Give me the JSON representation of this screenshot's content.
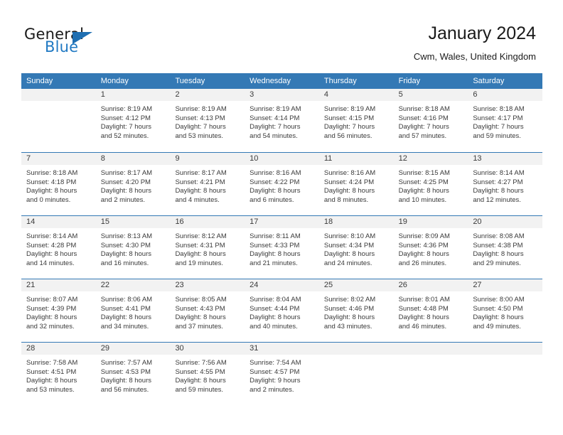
{
  "brand": {
    "word_general": "General",
    "word_blue": "Blue",
    "flag_icon": "triangle-flag-icon",
    "accent_color": "#2079c3"
  },
  "header": {
    "title": "January 2024",
    "subtitle": "Cwm, Wales, United Kingdom"
  },
  "calendar": {
    "header_bg": "#3479b5",
    "daynum_bg": "#f2f2f2",
    "weekdays": [
      "Sunday",
      "Monday",
      "Tuesday",
      "Wednesday",
      "Thursday",
      "Friday",
      "Saturday"
    ],
    "weeks": [
      [
        {
          "day": "",
          "lines": []
        },
        {
          "day": "1",
          "lines": [
            "Sunrise: 8:19 AM",
            "Sunset: 4:12 PM",
            "Daylight: 7 hours",
            "and 52 minutes."
          ]
        },
        {
          "day": "2",
          "lines": [
            "Sunrise: 8:19 AM",
            "Sunset: 4:13 PM",
            "Daylight: 7 hours",
            "and 53 minutes."
          ]
        },
        {
          "day": "3",
          "lines": [
            "Sunrise: 8:19 AM",
            "Sunset: 4:14 PM",
            "Daylight: 7 hours",
            "and 54 minutes."
          ]
        },
        {
          "day": "4",
          "lines": [
            "Sunrise: 8:19 AM",
            "Sunset: 4:15 PM",
            "Daylight: 7 hours",
            "and 56 minutes."
          ]
        },
        {
          "day": "5",
          "lines": [
            "Sunrise: 8:18 AM",
            "Sunset: 4:16 PM",
            "Daylight: 7 hours",
            "and 57 minutes."
          ]
        },
        {
          "day": "6",
          "lines": [
            "Sunrise: 8:18 AM",
            "Sunset: 4:17 PM",
            "Daylight: 7 hours",
            "and 59 minutes."
          ]
        }
      ],
      [
        {
          "day": "7",
          "lines": [
            "Sunrise: 8:18 AM",
            "Sunset: 4:18 PM",
            "Daylight: 8 hours",
            "and 0 minutes."
          ]
        },
        {
          "day": "8",
          "lines": [
            "Sunrise: 8:17 AM",
            "Sunset: 4:20 PM",
            "Daylight: 8 hours",
            "and 2 minutes."
          ]
        },
        {
          "day": "9",
          "lines": [
            "Sunrise: 8:17 AM",
            "Sunset: 4:21 PM",
            "Daylight: 8 hours",
            "and 4 minutes."
          ]
        },
        {
          "day": "10",
          "lines": [
            "Sunrise: 8:16 AM",
            "Sunset: 4:22 PM",
            "Daylight: 8 hours",
            "and 6 minutes."
          ]
        },
        {
          "day": "11",
          "lines": [
            "Sunrise: 8:16 AM",
            "Sunset: 4:24 PM",
            "Daylight: 8 hours",
            "and 8 minutes."
          ]
        },
        {
          "day": "12",
          "lines": [
            "Sunrise: 8:15 AM",
            "Sunset: 4:25 PM",
            "Daylight: 8 hours",
            "and 10 minutes."
          ]
        },
        {
          "day": "13",
          "lines": [
            "Sunrise: 8:14 AM",
            "Sunset: 4:27 PM",
            "Daylight: 8 hours",
            "and 12 minutes."
          ]
        }
      ],
      [
        {
          "day": "14",
          "lines": [
            "Sunrise: 8:14 AM",
            "Sunset: 4:28 PM",
            "Daylight: 8 hours",
            "and 14 minutes."
          ]
        },
        {
          "day": "15",
          "lines": [
            "Sunrise: 8:13 AM",
            "Sunset: 4:30 PM",
            "Daylight: 8 hours",
            "and 16 minutes."
          ]
        },
        {
          "day": "16",
          "lines": [
            "Sunrise: 8:12 AM",
            "Sunset: 4:31 PM",
            "Daylight: 8 hours",
            "and 19 minutes."
          ]
        },
        {
          "day": "17",
          "lines": [
            "Sunrise: 8:11 AM",
            "Sunset: 4:33 PM",
            "Daylight: 8 hours",
            "and 21 minutes."
          ]
        },
        {
          "day": "18",
          "lines": [
            "Sunrise: 8:10 AM",
            "Sunset: 4:34 PM",
            "Daylight: 8 hours",
            "and 24 minutes."
          ]
        },
        {
          "day": "19",
          "lines": [
            "Sunrise: 8:09 AM",
            "Sunset: 4:36 PM",
            "Daylight: 8 hours",
            "and 26 minutes."
          ]
        },
        {
          "day": "20",
          "lines": [
            "Sunrise: 8:08 AM",
            "Sunset: 4:38 PM",
            "Daylight: 8 hours",
            "and 29 minutes."
          ]
        }
      ],
      [
        {
          "day": "21",
          "lines": [
            "Sunrise: 8:07 AM",
            "Sunset: 4:39 PM",
            "Daylight: 8 hours",
            "and 32 minutes."
          ]
        },
        {
          "day": "22",
          "lines": [
            "Sunrise: 8:06 AM",
            "Sunset: 4:41 PM",
            "Daylight: 8 hours",
            "and 34 minutes."
          ]
        },
        {
          "day": "23",
          "lines": [
            "Sunrise: 8:05 AM",
            "Sunset: 4:43 PM",
            "Daylight: 8 hours",
            "and 37 minutes."
          ]
        },
        {
          "day": "24",
          "lines": [
            "Sunrise: 8:04 AM",
            "Sunset: 4:44 PM",
            "Daylight: 8 hours",
            "and 40 minutes."
          ]
        },
        {
          "day": "25",
          "lines": [
            "Sunrise: 8:02 AM",
            "Sunset: 4:46 PM",
            "Daylight: 8 hours",
            "and 43 minutes."
          ]
        },
        {
          "day": "26",
          "lines": [
            "Sunrise: 8:01 AM",
            "Sunset: 4:48 PM",
            "Daylight: 8 hours",
            "and 46 minutes."
          ]
        },
        {
          "day": "27",
          "lines": [
            "Sunrise: 8:00 AM",
            "Sunset: 4:50 PM",
            "Daylight: 8 hours",
            "and 49 minutes."
          ]
        }
      ],
      [
        {
          "day": "28",
          "lines": [
            "Sunrise: 7:58 AM",
            "Sunset: 4:51 PM",
            "Daylight: 8 hours",
            "and 53 minutes."
          ]
        },
        {
          "day": "29",
          "lines": [
            "Sunrise: 7:57 AM",
            "Sunset: 4:53 PM",
            "Daylight: 8 hours",
            "and 56 minutes."
          ]
        },
        {
          "day": "30",
          "lines": [
            "Sunrise: 7:56 AM",
            "Sunset: 4:55 PM",
            "Daylight: 8 hours",
            "and 59 minutes."
          ]
        },
        {
          "day": "31",
          "lines": [
            "Sunrise: 7:54 AM",
            "Sunset: 4:57 PM",
            "Daylight: 9 hours",
            "and 2 minutes."
          ]
        },
        {
          "day": "",
          "lines": []
        },
        {
          "day": "",
          "lines": []
        },
        {
          "day": "",
          "lines": []
        }
      ]
    ]
  }
}
